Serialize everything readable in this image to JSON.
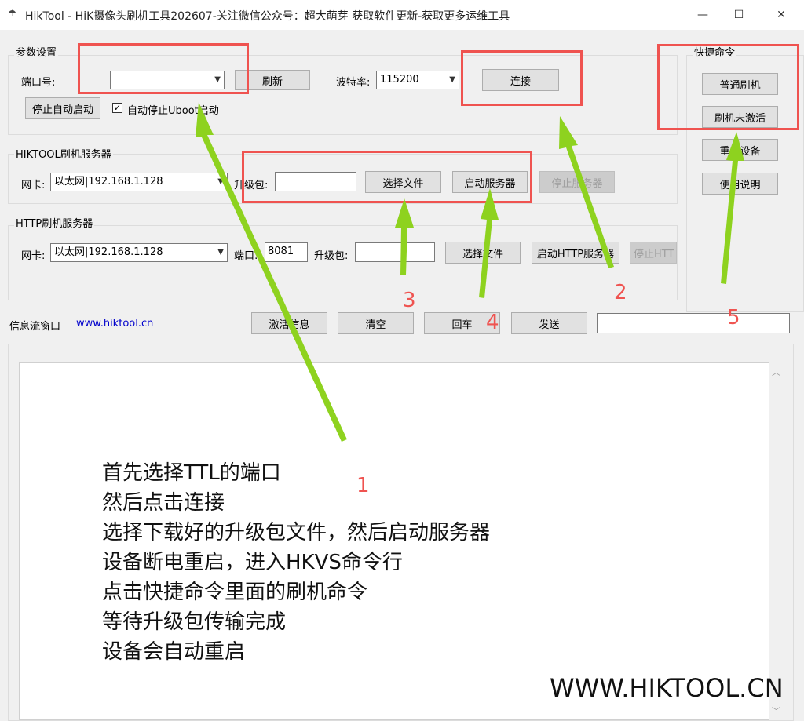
{
  "window": {
    "title": "HikTool - HiK摄像头刷机工具202607-关注微信公众号：超大萌芽 获取软件更新-获取更多运维工具",
    "minimize": "—",
    "maximize": "☐",
    "close": "✕"
  },
  "params": {
    "group_label": "参数设置",
    "port_label": "端口号:",
    "port_value": "",
    "refresh_button": "刷新",
    "baud_label": "波特率:",
    "baud_value": "115200",
    "connect_button": "连接",
    "stop_autostart_button": "停止自动启动",
    "auto_stop_uboot_checked": "✓",
    "auto_stop_uboot_label": "自动停止Uboot启动"
  },
  "hiktool_server": {
    "group_label": "HIKTOOL刷机服务器",
    "nic_label": "网卡:",
    "nic_value": "以太网|192.168.1.128",
    "package_label": "升级包:",
    "package_value": "",
    "choose_file_button": "选择文件",
    "start_server_button": "启动服务器",
    "stop_server_button": "停止服务器"
  },
  "http_server": {
    "group_label": "HTTP刷机服务器",
    "nic_label": "网卡:",
    "nic_value": "以太网|192.168.1.128",
    "port_label": "端口:",
    "port_value": "8081",
    "package_label": "升级包:",
    "package_value": "",
    "choose_file_button": "选择文件",
    "start_http_button": "启动HTTP服务器",
    "stop_http_button": "停止HTT"
  },
  "quick_commands": {
    "group_label": "快捷命令",
    "normal_flash_button": "普通刷机",
    "flash_not_activated_button": "刷机未激活",
    "reboot_device_button": "重启设备",
    "usage_button": "使用说明"
  },
  "info_stream": {
    "label": "信息流窗口",
    "link": "www.hiktool.cn",
    "activate_info_button": "激活信息",
    "clear_button": "清空",
    "enter_button": "回车",
    "send_button": "发送",
    "send_input_value": ""
  },
  "annotations": {
    "num1": "1",
    "num2": "2",
    "num3": "3",
    "num4": "4",
    "num5": "5",
    "instructions": [
      "首先选择TTL的端口",
      "然后点击连接",
      "选择下载好的升级包文件，然后启动服务器",
      "设备断电重启，进入HKVS命令行",
      "点击快捷命令里面的刷机命令",
      "等待升级包传输完成",
      "设备会自动重启"
    ],
    "watermark": "WWW.HIKTOOL.CN"
  },
  "colors": {
    "annotation_red": "#ef5350",
    "arrow_green": "#8ed21f",
    "link_blue": "#0000cc"
  }
}
